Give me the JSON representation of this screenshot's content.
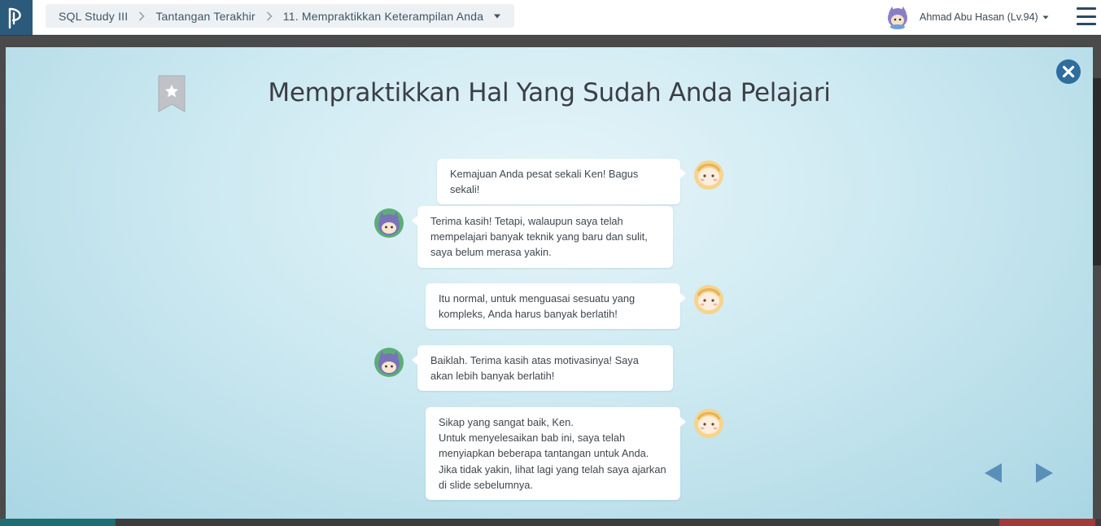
{
  "breadcrumb": {
    "items": [
      "SQL Study III",
      "Tantangan Terakhir",
      "11. Mempraktikkan Keterampilan Anda"
    ]
  },
  "user": {
    "name": "Ahmad Abu Hasan (Lv.94)"
  },
  "modal": {
    "title": "Mempraktikkan Hal Yang Sudah Anda Pelajari",
    "messages": [
      {
        "speaker": "mentor",
        "text": "Kemajuan Anda pesat sekali Ken! Bagus sekali!"
      },
      {
        "speaker": "ken",
        "text": "Terima kasih! Tetapi, walaupun saya telah\nmempelajari banyak teknik yang baru dan sulit,\nsaya belum merasa yakin."
      },
      {
        "speaker": "mentor",
        "text": "Itu normal, untuk menguasai sesuatu yang\nkompleks, Anda harus banyak berlatih!"
      },
      {
        "speaker": "ken",
        "text": "Baiklah. Terima kasih atas motivasinya! Saya\nakan lebih banyak berlatih!"
      },
      {
        "speaker": "mentor",
        "text": "Sikap yang sangat baik, Ken.\nUntuk menyelesaikan bab ini, saya telah\nmenyiapkan beberapa tantangan untuk Anda.\nJika tidak yakin, lihat lagi yang telah saya ajarkan\ndi slide sebelumnya."
      }
    ]
  },
  "colors": {
    "brand": "#2b5a7a",
    "accent_blue": "#3a7aa8",
    "nav_arrow": "#5a8fb8"
  },
  "icons": [
    "logo-icon",
    "chevron-right-icon",
    "caret-down-icon",
    "user-avatar-icon",
    "hamburger-menu-icon",
    "bookmark-star-icon",
    "close-icon",
    "mentor-avatar-icon",
    "ken-avatar-icon",
    "prev-arrow-icon",
    "next-arrow-icon"
  ]
}
